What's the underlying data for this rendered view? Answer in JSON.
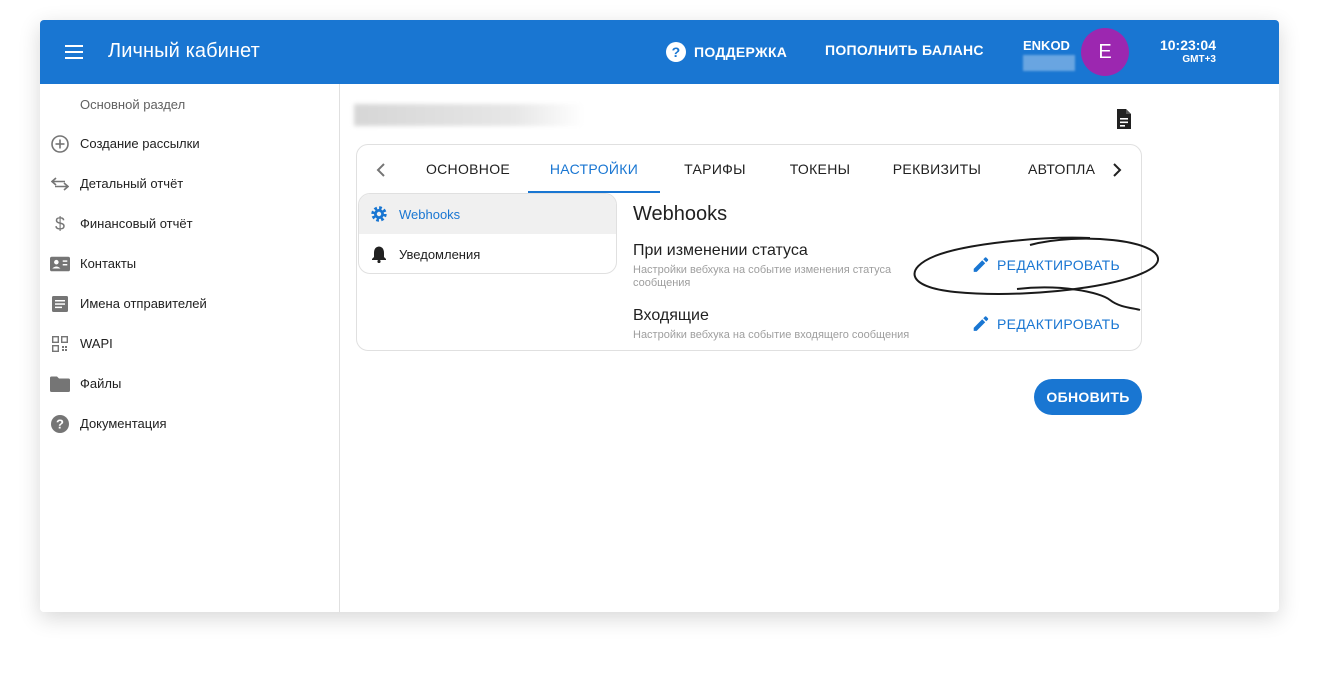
{
  "header": {
    "title": "Личный кабинет",
    "support_label": "ПОДДЕРЖКА",
    "balance_label": "ПОПОЛНИТЬ БАЛАНС",
    "account_name": "ENKOD",
    "avatar_letter": "E",
    "time": "10:23:04",
    "timezone": "GMT+3",
    "accent_color": "#1976d2",
    "avatar_color": "#9c27b0"
  },
  "sidebar": {
    "section_label": "Основной раздел",
    "items": [
      {
        "label": "Создание рассылки",
        "icon": "add-circle-icon"
      },
      {
        "label": "Детальный отчёт",
        "icon": "swap-arrows-icon"
      },
      {
        "label": "Финансовый отчёт",
        "icon": "dollar-icon"
      },
      {
        "label": "Контакты",
        "icon": "contact-card-icon"
      },
      {
        "label": "Имена отправителей",
        "icon": "document-list-icon"
      },
      {
        "label": "WAPI",
        "icon": "qr-code-icon"
      },
      {
        "label": "Файлы",
        "icon": "folder-icon"
      },
      {
        "label": "Документация",
        "icon": "help-circle-icon"
      }
    ]
  },
  "tabs": {
    "items": [
      "ОСНОВНОЕ",
      "НАСТРОЙКИ",
      "ТАРИФЫ",
      "ТОКЕНЫ",
      "РЕКВИЗИТЫ",
      "АВТОПЛА"
    ],
    "active": "НАСТРОЙКИ"
  },
  "settings_menu": {
    "items": [
      {
        "label": "Webhooks",
        "icon": "gear-icon",
        "active": true
      },
      {
        "label": "Уведомления",
        "icon": "bell-icon",
        "active": false
      }
    ]
  },
  "webhooks": {
    "title": "Webhooks",
    "entries": [
      {
        "title": "При изменении статуса",
        "description": "Настройки вебхука на событие изменения статуса сообщения",
        "action": "РЕДАКТИРОВАТЬ"
      },
      {
        "title": "Входящие",
        "description": "Настройки вебхука на событие входящего сообщения",
        "action": "РЕДАКТИРОВАТЬ"
      }
    ]
  },
  "refresh_label": "ОБНОВИТЬ"
}
